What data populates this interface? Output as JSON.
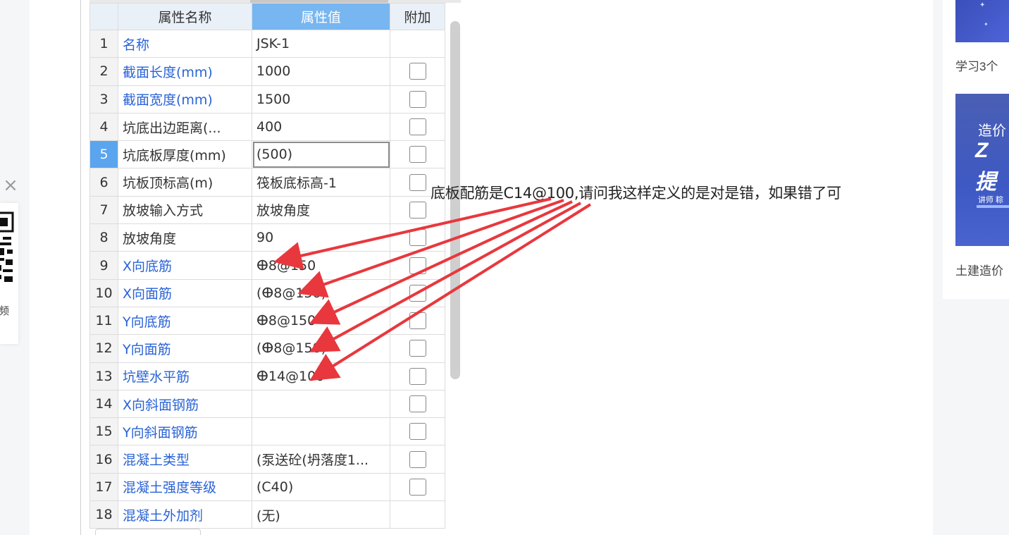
{
  "left_panel": {
    "close_glyph": "×",
    "qr_caption": "频"
  },
  "table": {
    "headers": [
      "属性名称",
      "属性值",
      "附加"
    ],
    "rows": [
      {
        "num": "1",
        "name": "名称",
        "value": "JSK-1",
        "checkbox": false
      },
      {
        "num": "2",
        "name": "截面长度(mm)",
        "value": "1000",
        "checkbox": true
      },
      {
        "num": "3",
        "name": "截面宽度(mm)",
        "value": "1500",
        "checkbox": true
      },
      {
        "num": "4",
        "name": "坑底出边距离(...",
        "value": "400",
        "checkbox": true
      },
      {
        "num": "5",
        "name": "坑底板厚度(mm)",
        "value": "(500)",
        "checkbox": true
      },
      {
        "num": "6",
        "name": "坑板顶标高(m)",
        "value": "筏板底标高-1",
        "checkbox": true
      },
      {
        "num": "7",
        "name": "放坡输入方式",
        "value": "放坡角度",
        "checkbox": true
      },
      {
        "num": "8",
        "name": "放坡角度",
        "value": "90",
        "checkbox": true
      },
      {
        "num": "9",
        "name": "X向底筋",
        "value": "ⴲ8@150",
        "checkbox": true
      },
      {
        "num": "10",
        "name": "X向面筋",
        "value": "(ⴲ8@150)",
        "checkbox": true
      },
      {
        "num": "11",
        "name": "Y向底筋",
        "value": "ⴲ8@150",
        "checkbox": true
      },
      {
        "num": "12",
        "name": "Y向面筋",
        "value": "(ⴲ8@150)",
        "checkbox": true
      },
      {
        "num": "13",
        "name": "坑壁水平筋",
        "value": "ⴲ14@100",
        "checkbox": true
      },
      {
        "num": "14",
        "name": "X向斜面钢筋",
        "value": "",
        "checkbox": true
      },
      {
        "num": "15",
        "name": "Y向斜面钢筋",
        "value": "",
        "checkbox": true
      },
      {
        "num": "16",
        "name": "混凝土类型",
        "value": "(泵送砼(坍落度1...",
        "checkbox": true
      },
      {
        "num": "17",
        "name": "混凝土强度等级",
        "value": "(C40)",
        "checkbox": true
      },
      {
        "num": "18",
        "name": "混凝土外加剂",
        "value": "(无)",
        "checkbox": false
      }
    ]
  },
  "question_text": "底板配筋是C14@100,请问我这样定义的是对是错，如果错了可",
  "sidebar": {
    "caption1": "学习3个",
    "caption2": "土建造价",
    "thumb2_line1": "造价",
    "thumb2_line2": "Z",
    "thumb2_line3": "提",
    "thumb2_line4": "讲师 粽"
  },
  "colors": {
    "arrow": "#e8383d",
    "blue_label": "#2a63d6",
    "header_selected": "#77b6f0"
  }
}
